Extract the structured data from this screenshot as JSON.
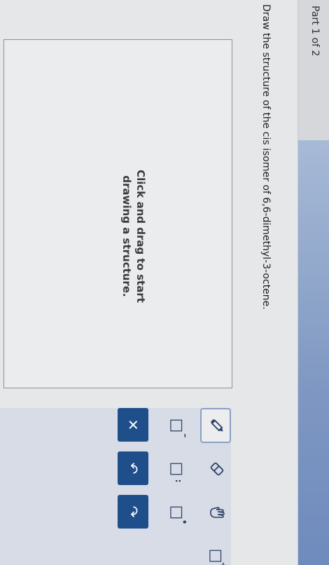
{
  "header": {
    "part_label": "Part 1 of 2"
  },
  "question": {
    "text": "Draw the structure of the cis isomer of 6,6-dimethyl-3-octene."
  },
  "drawing_area": {
    "hint_line1": "Click and drag to start",
    "hint_line2": "drawing a structure."
  },
  "toolbar": {
    "tools": [
      {
        "name": "pencil-tool",
        "icon": "pencil-icon",
        "selected": true
      },
      {
        "name": "eraser-tool",
        "icon": "eraser-icon",
        "selected": false
      },
      {
        "name": "grab-tool",
        "icon": "hand-icon",
        "selected": false
      },
      {
        "name": "add-atom-tool",
        "icon": "atom-plus-icon",
        "selected": false
      },
      {
        "name": "charge-tool",
        "icon": "charge-icon",
        "selected": false
      },
      {
        "name": "lone-pair-tool",
        "icon": "lone-pair-icon",
        "selected": false
      },
      {
        "name": "radical-tool",
        "icon": "radical-icon",
        "selected": false
      }
    ],
    "actions": [
      {
        "name": "clear-button",
        "icon": "close-icon",
        "symbol": "✕"
      },
      {
        "name": "undo-button",
        "icon": "undo-icon",
        "symbol": "↶"
      },
      {
        "name": "redo-button",
        "icon": "redo-icon",
        "symbol": "↷"
      }
    ]
  },
  "colors": {
    "accent": "#1f4f8a",
    "header_bar": "#7e97c2",
    "toolbar_bg": "#d7dce6"
  }
}
